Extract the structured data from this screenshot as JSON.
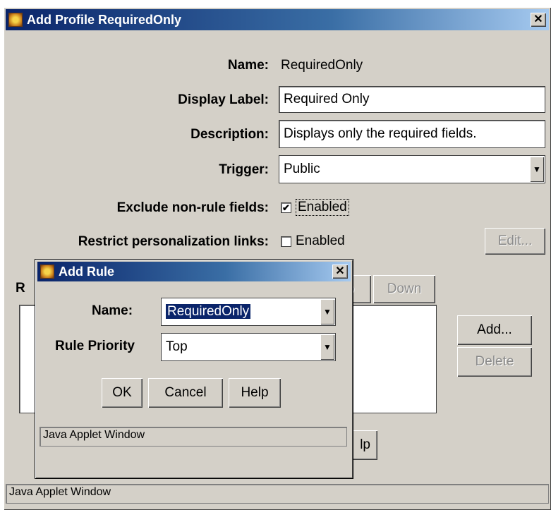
{
  "main_window": {
    "title": "Add Profile RequiredOnly",
    "close": "✕",
    "name_label": "Name:",
    "name_value": "RequiredOnly",
    "display_label_label": "Display Label:",
    "display_label_value": "Required Only",
    "description_label": "Description:",
    "description_value": "Displays only the required fields.",
    "trigger_label": "Trigger:",
    "trigger_value": "Public",
    "exclude_label": "Exclude non-rule fields:",
    "exclude_check_label": "Enabled",
    "exclude_checked": true,
    "restrict_label": "Restrict personalization links:",
    "restrict_check_label": "Enabled",
    "restrict_checked": false,
    "edit_button": "Edit...",
    "rules_label_partial": "R",
    "up_button_partial": "p",
    "down_button": "Down",
    "add_button": "Add...",
    "delete_button": "Delete",
    "help_button_partial": "lp",
    "status": "Java Applet Window"
  },
  "add_rule_dialog": {
    "title": "Add Rule",
    "close": "✕",
    "name_label": "Name:",
    "name_value": "RequiredOnly",
    "priority_label": "Rule Priority",
    "priority_value": "Top",
    "ok_button": "OK",
    "cancel_button": "Cancel",
    "help_button": "Help",
    "status": "Java Applet Window"
  },
  "icons": {
    "close": "close-icon",
    "dropdown": "chevron-down-icon",
    "check": "checkmark-icon"
  }
}
